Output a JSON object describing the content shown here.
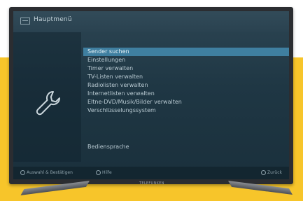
{
  "screen": {
    "title": "Hauptmenü"
  },
  "menu": {
    "items": [
      {
        "label": "Sender suchen",
        "selected": true
      },
      {
        "label": "Einstellungen",
        "selected": false
      },
      {
        "label": "Timer verwalten",
        "selected": false
      },
      {
        "label": "TV-Listen verwalten",
        "selected": false
      },
      {
        "label": "Radiolisten verwalten",
        "selected": false
      },
      {
        "label": "Internetlisten verwalten",
        "selected": false
      },
      {
        "label": "Eltne-DVD/Musik/Bilder verwalten",
        "selected": false
      },
      {
        "label": "Verschlüsselungssystem",
        "selected": false
      }
    ],
    "language_item": "Bediensprache"
  },
  "bottom_bar": {
    "hint_left": "Auswahl & Bestätigen",
    "hint_middle": "Hilfe",
    "hint_right": "Zurück"
  },
  "tv": {
    "brand": "TELEFUNKEN"
  },
  "colors": {
    "background_accent": "#f7c52a",
    "screen_bg": "#1f3744",
    "selection": "#3f7fa0",
    "tv_frame": "#2b2d31"
  },
  "icons": {
    "menu": "menu-icon",
    "settings": "wrench-icon"
  }
}
